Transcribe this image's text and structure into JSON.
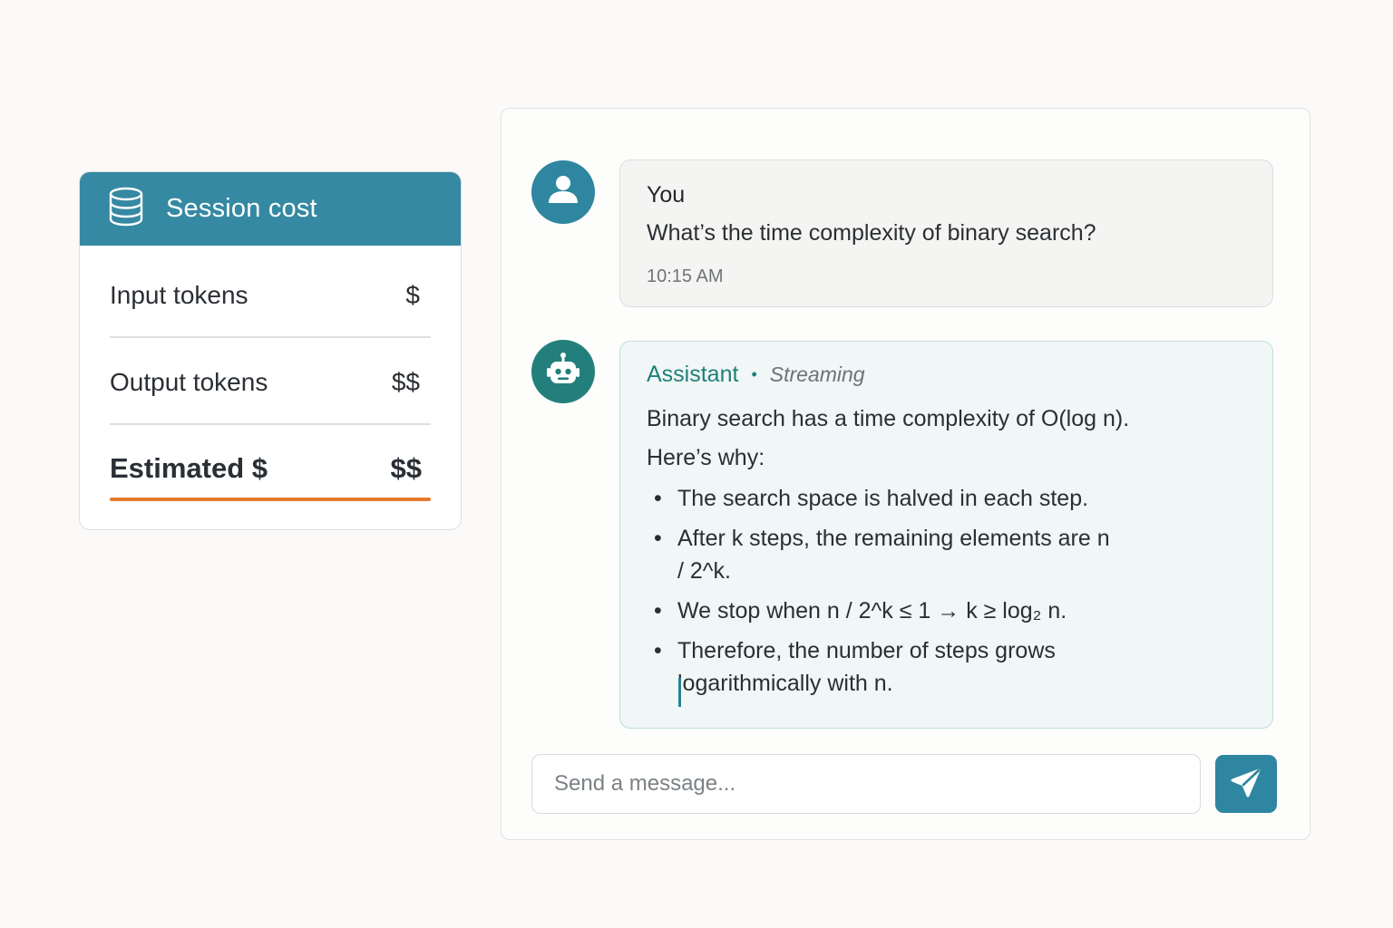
{
  "session_cost": {
    "title": "Session cost",
    "icon": "database-icon",
    "rows": [
      {
        "label": "Input tokens",
        "value": "$"
      },
      {
        "label": "Output tokens",
        "value": "$$"
      },
      {
        "label": "Estimated $",
        "value": "$$"
      }
    ],
    "colors": {
      "header": "#3589a2",
      "accent": "#e57a2c"
    }
  },
  "chat": {
    "user_message": {
      "author": "You",
      "text": "What’s the time complexity of binary search?",
      "time": "10:15 AM",
      "avatar_icon": "user-icon"
    },
    "assistant_message": {
      "author": "Assistant",
      "status": "Streaming",
      "avatar_icon": "robot-icon",
      "intro": "Binary search has a time complexity of O(log n).",
      "lead": "Here’s why:",
      "bullets": [
        "The search space is halved in each step.",
        "After k steps, the remaining elements are n / 2^k.",
        "We stop when n / 2^k ≤ 1 → k ≥ log₂ n.",
        "Therefore, the number of steps grows logarithmically with n."
      ]
    },
    "composer": {
      "placeholder": "Send a message...",
      "send_icon": "send-icon"
    },
    "colors": {
      "user_avatar": "#2f86a0",
      "assistant_avatar": "#237f7c",
      "assistant_accent": "#1f7f7a"
    }
  }
}
